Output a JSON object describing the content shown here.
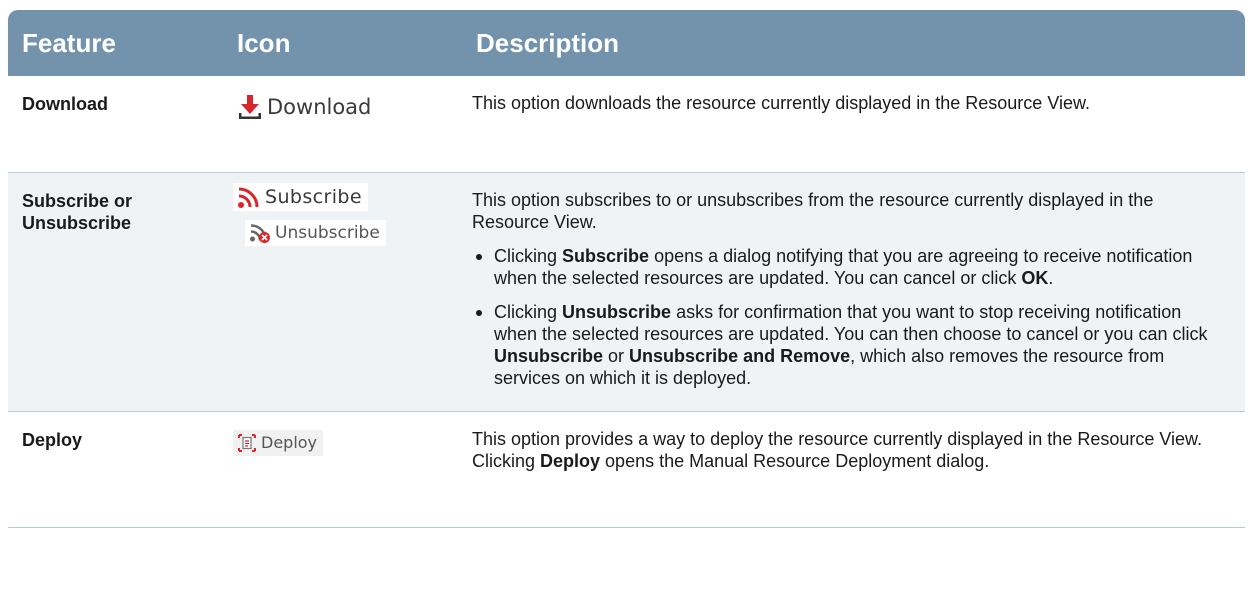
{
  "header": {
    "feature": "Feature",
    "icon": "Icon",
    "description": "Description"
  },
  "rows": {
    "download": {
      "feature": "Download",
      "icon_label": "Download",
      "icon": "download-icon",
      "description": "This option downloads the resource currently displayed in the Resource View."
    },
    "subscribe": {
      "feature_line1": "Subscribe or",
      "feature_line2": "Unsubscribe",
      "icon_label_subscribe": "Subscribe",
      "icon_label_unsubscribe": "Unsubscribe",
      "icon_subscribe": "rss-icon",
      "icon_unsubscribe": "rss-remove-icon",
      "description": "This option subscribes to or unsubscribes from the resource currently displayed in the Resource View.",
      "bullet1": {
        "pre": "Clicking ",
        "b1": "Subscribe",
        "mid": " opens a dialog notifying that you are agreeing to receive notification when the selected resources are updated. You can cancel or click ",
        "b2": "OK",
        "post": "."
      },
      "bullet2": {
        "pre": "Clicking ",
        "b1": "Unsubscribe",
        "mid1": " asks for confirmation that you want to stop receiving notification when the selected resources are updated. You can then choose to cancel or you can click ",
        "b2": "Unsubscribe",
        "mid2": " or ",
        "b3": "Unsubscribe and Remove",
        "post": ", which also removes the resource from services on which it is deployed."
      }
    },
    "deploy": {
      "feature": "Deploy",
      "icon_label": "Deploy",
      "icon": "deploy-icon",
      "pre": "This option provides a way to deploy the resource currently displayed in the Resource View. Clicking ",
      "b1": "Deploy",
      "post": " opens the Manual Resource Deployment dialog."
    }
  },
  "colors": {
    "header_bg": "#7393ad",
    "row_alt_bg": "#f0f3f6",
    "icon_red": "#d9262b"
  }
}
